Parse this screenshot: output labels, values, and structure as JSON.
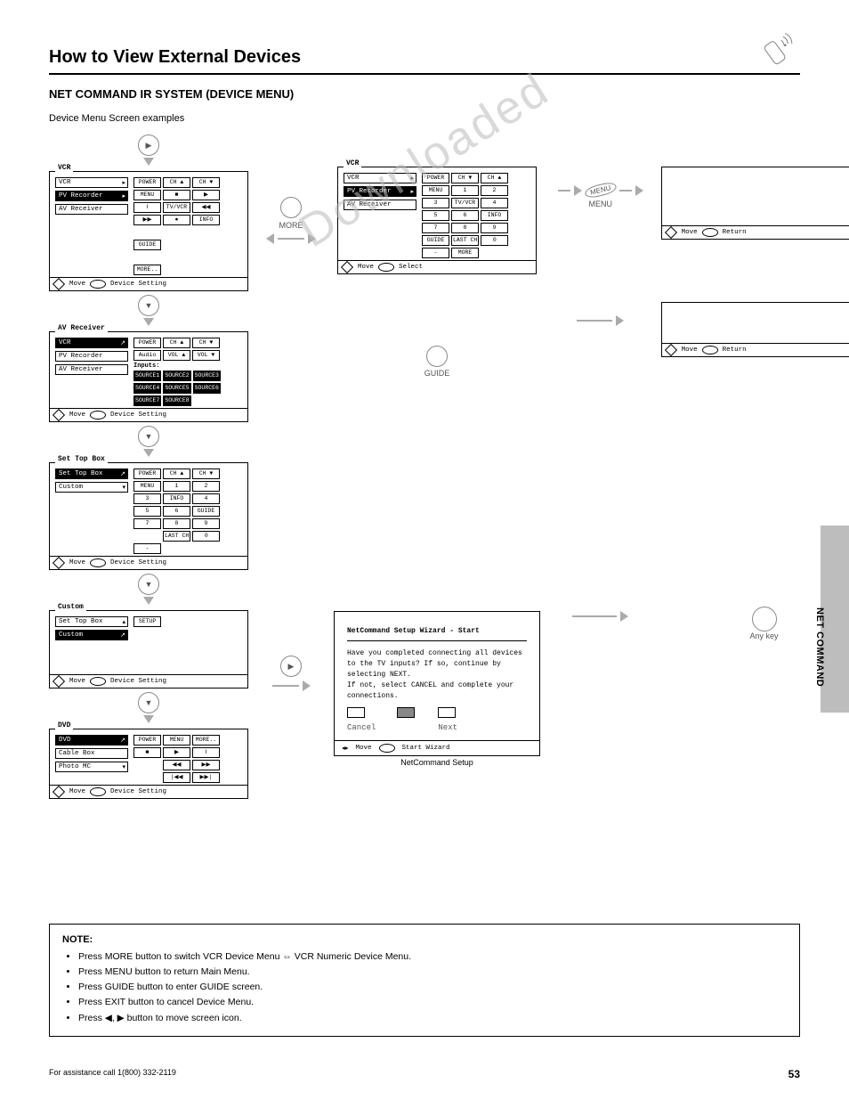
{
  "header": {
    "title": "How to View External Devices",
    "section": "NET COMMAND IR SYSTEM (DEVICE MENU)"
  },
  "sub": "Device Menu Screen examples",
  "tab": "NET COMMAND",
  "panels": {
    "p1": {
      "title": "VCR",
      "devs": [
        "VCR",
        "PV Recorder",
        "AV Receiver"
      ],
      "selIndex": -1,
      "btns": [
        "POWER",
        "CH ▲",
        "CH ▼",
        "MENU",
        "■",
        "▶",
        "‖",
        "TV/VCR",
        "◀◀",
        "▶▶",
        "●",
        "INFO",
        "GUIDE",
        "MORE.."
      ],
      "foot": {
        "move": "Move",
        "right": "Device Setting"
      }
    },
    "p1b": {
      "title": "VCR",
      "devs": [
        "VCR",
        "PV Recorder",
        "AV Receiver"
      ],
      "selIndex": -1,
      "btns": [
        "POWER",
        "CH ▼",
        "CH ▲",
        "MENU",
        "1",
        "2",
        "3",
        "TV/VCR",
        "4",
        "5",
        "6",
        "INFO",
        "7",
        "8",
        "9",
        "GUIDE",
        "LAST CH",
        "0",
        "-",
        "MORE"
      ],
      "foot": {
        "move": "Move",
        "right": "Select"
      }
    },
    "p2": {
      "title": "AV Receiver",
      "devs": [
        "VCR",
        "PV Recorder",
        "AV Receiver"
      ],
      "selIndex": 0,
      "topBtns": [
        "POWER",
        "CH ▲",
        "CH ▼",
        "Audio",
        "VOL ▲",
        "VOL ▼"
      ],
      "inputsLabel": "Inputs:",
      "inputs": [
        "SOURCE1",
        "SOURCE2",
        "SOURCE3",
        "SOURCE4",
        "SOURCE5",
        "SOURCE6",
        "SOURCE7",
        "SOURCE8"
      ],
      "foot": {
        "move": "Move",
        "right": "Device Setting"
      }
    },
    "p3": {
      "title": "Set Top Box",
      "devs": [
        "Set Top Box",
        "Custom"
      ],
      "selIndex": 0,
      "btns": [
        "POWER",
        "CH ▲",
        "CH ▼",
        "MENU",
        "1",
        "2",
        "3",
        "INFO",
        "4",
        "5",
        "6",
        "GUIDE",
        "7",
        "8",
        "9",
        "LAST CH",
        "0",
        "-"
      ],
      "foot": {
        "move": "Move",
        "right": "Device Setting"
      }
    },
    "p4": {
      "title": "Custom",
      "devs": [
        "Set Top Box",
        "Custom"
      ],
      "selIndex": 1,
      "btns": [
        "SETUP"
      ],
      "foot": {
        "move": "Move",
        "right": "Device Setting"
      }
    },
    "p5": {
      "title": "DVD",
      "devs": [
        "DVD",
        "Cable Box",
        "Photo MC"
      ],
      "selIndex": 0,
      "btns": [
        "POWER",
        "MENU",
        "MORE..",
        "■",
        "▶",
        "‖",
        "◀◀",
        "▶▶",
        "|◀◀",
        "▶▶|"
      ],
      "foot": {
        "move": "Move",
        "right": "Device Setting"
      }
    }
  },
  "wizard": {
    "title": "NetCommand Setup Wizard - Start",
    "body": "Have you completed connecting all devices to the TV inputs? If so, continue by selecting NEXT.\nIf not, select CANCEL and complete your connections.",
    "cancel": "Cancel",
    "next": "Next",
    "footMove": "Move",
    "footStart": "Start Wizard"
  },
  "labels": {
    "more": "MORE",
    "menu": "MENU",
    "guide": "GUIDE",
    "anyKey": "Any key",
    "netcmdSetup": "NetCommand Setup",
    "return": "Return",
    "move": "Move",
    "circArrow": "▶"
  },
  "rtn": {
    "move": "Move",
    "return": "Return"
  },
  "note": {
    "heading": "NOTE:",
    "items": [
      "Press MORE button to switch VCR Device Menu ⇔ VCR Numeric Device Menu.",
      "Press MENU button to return Main Menu.",
      "Press GUIDE button to enter GUIDE screen.",
      "Press EXIT button to cancel Device Menu.",
      "Press ◀, ▶ button to move screen icon."
    ]
  },
  "footer": {
    "left": "For assistance call 1(800) 332-2119",
    "right": "53"
  }
}
